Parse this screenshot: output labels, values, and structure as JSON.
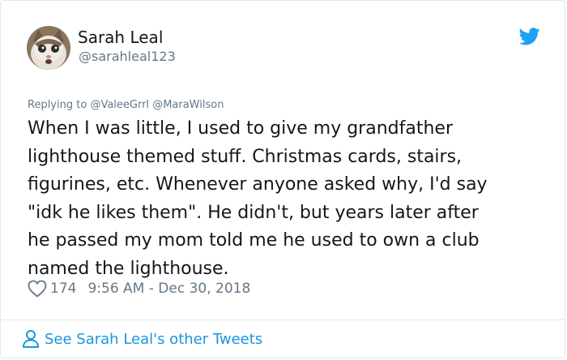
{
  "author": {
    "name": "Sarah Leal",
    "handle": "@sarahleal123",
    "avatar_icon": "cat-avatar"
  },
  "reply": {
    "prefix": "Replying to",
    "mentions": [
      "@ValeeGrrl",
      "@MaraWilson"
    ]
  },
  "tweet": {
    "text": "When I was little, I used to give my grandfather\nlighthouse themed stuff. Christmas cards, stairs,\nfigurines, etc. Whenever anyone asked why, I'd say\n\"idk he likes them\". He didn't, but years later after\nhe passed my mom told me he used to own a club\nnamed the lighthouse."
  },
  "meta": {
    "likes": "174",
    "timestamp": "9:56 AM - Dec 30, 2018",
    "heart_icon": "heart-icon"
  },
  "footer": {
    "link_label": "See Sarah Leal's other Tweets",
    "icon": "person-icon"
  },
  "colors": {
    "twitter_blue": "#1da1f2",
    "link_blue": "#1b95e0",
    "secondary_text": "#657786",
    "primary_text": "#14171a",
    "border": "#e1e8ed"
  }
}
